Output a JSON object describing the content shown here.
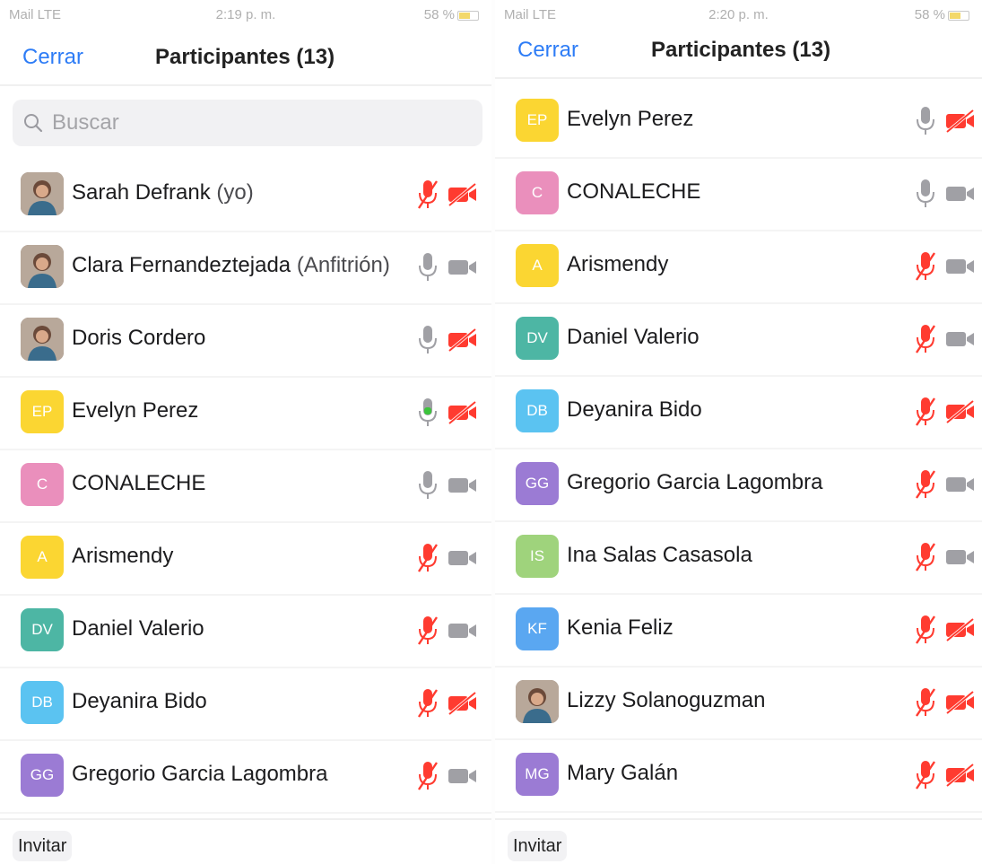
{
  "colors": {
    "accent": "#2d7cf6",
    "muted_red": "#ff3b30",
    "icon_gray": "#a0a0a5",
    "talking_green": "#3cc43c"
  },
  "panels": [
    {
      "status": {
        "left": "Mail LTE",
        "time": "2:19 p. m.",
        "right": "58 %"
      },
      "nav": {
        "close_label": "Cerrar",
        "title": "Participantes (13)"
      },
      "search": {
        "placeholder": "Buscar",
        "icon": "search-icon"
      },
      "participants": [
        {
          "initials": "",
          "photo": true,
          "name": "Sarah Defrank",
          "suffix": " (yo)",
          "mic": "muted",
          "cam": "off"
        },
        {
          "initials": "",
          "photo": true,
          "name": "Clara Fernandeztejada",
          "suffix": " (Anfitrión)",
          "mic": "on",
          "cam": "on"
        },
        {
          "initials": "",
          "photo": true,
          "name": "Doris Cordero",
          "suffix": "",
          "mic": "on",
          "cam": "off"
        },
        {
          "initials": "EP",
          "color": "#fbd632",
          "name": "Evelyn Perez",
          "suffix": "",
          "mic": "talking",
          "cam": "off"
        },
        {
          "initials": "C",
          "color": "#ea8fbc",
          "name": "CONALECHE",
          "suffix": "",
          "mic": "on",
          "cam": "on"
        },
        {
          "initials": "A",
          "color": "#fbd632",
          "name": "Arismendy",
          "suffix": "",
          "mic": "muted",
          "cam": "on"
        },
        {
          "initials": "DV",
          "color": "#4db6a4",
          "name": "Daniel Valerio",
          "suffix": "",
          "mic": "muted",
          "cam": "on"
        },
        {
          "initials": "DB",
          "color": "#5bc3f1",
          "name": "Deyanira Bido",
          "suffix": "",
          "mic": "muted",
          "cam": "off"
        },
        {
          "initials": "GG",
          "color": "#9b7bd4",
          "name": "Gregorio Garcia Lagombra",
          "suffix": "",
          "mic": "muted",
          "cam": "on"
        }
      ],
      "invite_label": "Invitar"
    },
    {
      "status": {
        "left": "Mail LTE",
        "time": "2:20 p. m.",
        "right": "58 %"
      },
      "nav": {
        "close_label": "Cerrar",
        "title": "Participantes (13)"
      },
      "participants": [
        {
          "initials": "EP",
          "color": "#fbd632",
          "name": "Evelyn Perez",
          "suffix": "",
          "mic": "on",
          "cam": "off"
        },
        {
          "initials": "C",
          "color": "#ea8fbc",
          "name": "CONALECHE",
          "suffix": "",
          "mic": "on",
          "cam": "on"
        },
        {
          "initials": "A",
          "color": "#fbd632",
          "name": "Arismendy",
          "suffix": "",
          "mic": "muted",
          "cam": "on"
        },
        {
          "initials": "DV",
          "color": "#4db6a4",
          "name": "Daniel Valerio",
          "suffix": "",
          "mic": "muted",
          "cam": "on"
        },
        {
          "initials": "DB",
          "color": "#5bc3f1",
          "name": "Deyanira Bido",
          "suffix": "",
          "mic": "muted",
          "cam": "off"
        },
        {
          "initials": "GG",
          "color": "#9b7bd4",
          "name": "Gregorio Garcia Lagombra",
          "suffix": "",
          "mic": "muted",
          "cam": "on"
        },
        {
          "initials": "IS",
          "color": "#9fd37c",
          "name": "Ina Salas Casasola",
          "suffix": "",
          "mic": "muted",
          "cam": "on"
        },
        {
          "initials": "KF",
          "color": "#5aa7f1",
          "name": "Kenia Feliz",
          "suffix": "",
          "mic": "muted",
          "cam": "off"
        },
        {
          "initials": "",
          "photo": true,
          "name": "Lizzy Solanoguzman",
          "suffix": "",
          "mic": "muted",
          "cam": "off"
        },
        {
          "initials": "MG",
          "color": "#9b7bd4",
          "name": "Mary Galán",
          "suffix": "",
          "mic": "muted",
          "cam": "off"
        }
      ],
      "invite_label": "Invitar"
    }
  ]
}
